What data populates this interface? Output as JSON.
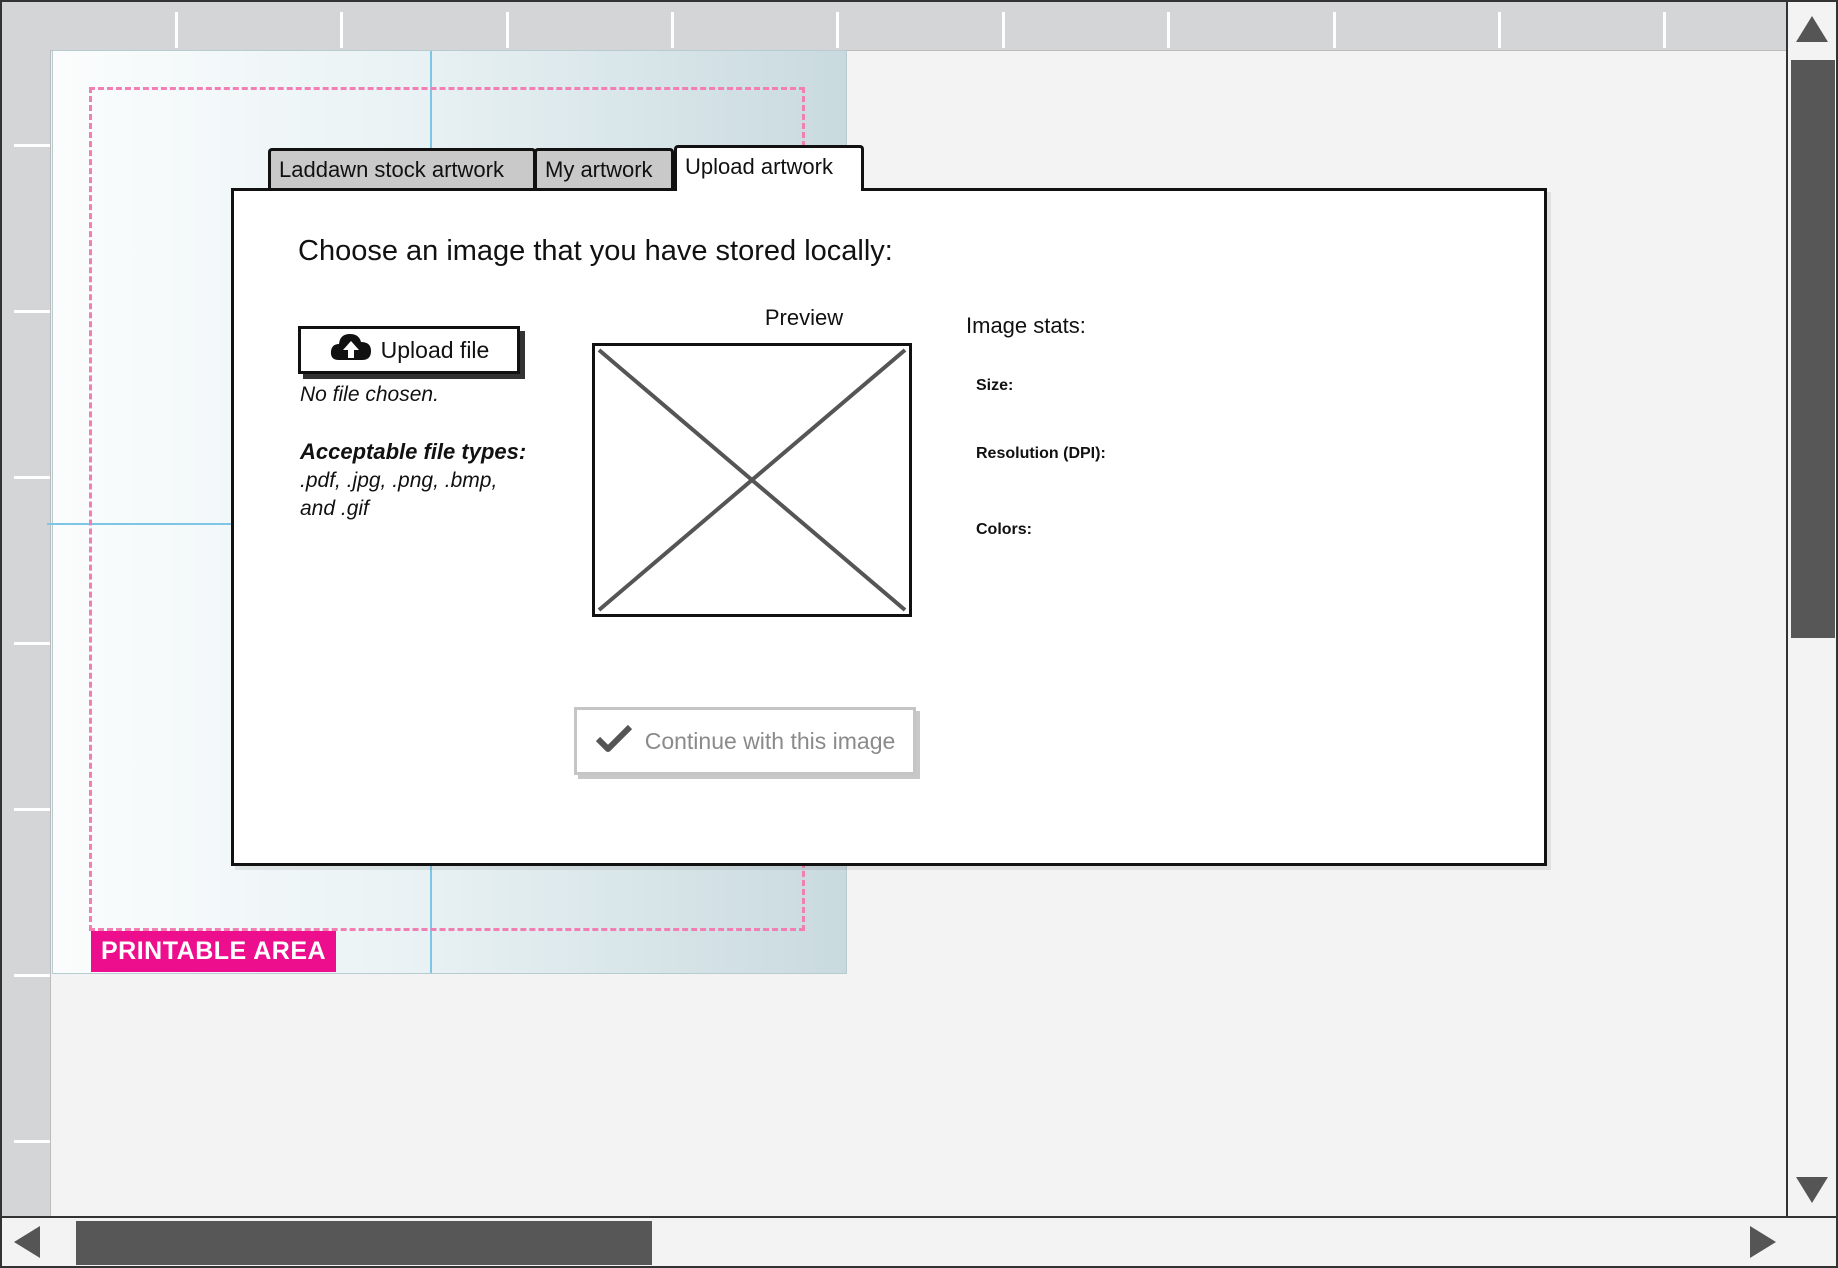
{
  "canvas": {
    "printable_label": "PRINTABLE AREA"
  },
  "tabs": [
    {
      "label": "Laddawn stock artwork",
      "active": false
    },
    {
      "label": "My artwork",
      "active": false
    },
    {
      "label": "Upload artwork",
      "active": true
    }
  ],
  "upload": {
    "heading": "Choose an image that you have stored locally:",
    "button_label": "Upload file",
    "button_icon": "cloud-upload-icon",
    "status": "No file chosen.",
    "types_label": "Acceptable file types:",
    "types_list": ".pdf, .jpg, .png, .bmp, and .gif"
  },
  "preview": {
    "label": "Preview",
    "placeholder_icon": "image-placeholder-icon"
  },
  "stats": {
    "title": "Image stats:",
    "size_label": "Size:",
    "resolution_label": "Resolution (DPI):",
    "colors_label": "Colors:"
  },
  "actions": {
    "continue_label": "Continue with this image",
    "continue_icon": "checkmark-icon"
  },
  "colors": {
    "printable_badge": "#ec0e8c",
    "dashed_border": "#f27fb3",
    "guide_line": "#7fc6e6",
    "scroll_thumb": "#575757"
  }
}
